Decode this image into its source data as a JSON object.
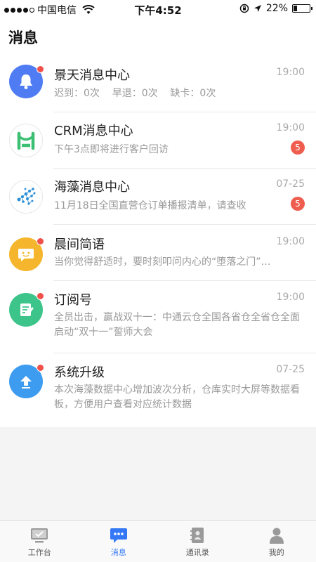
{
  "status": {
    "carrier": "中国电信",
    "time": "下午4:52",
    "battery": "22%",
    "battery_level": 0.22
  },
  "header": {
    "title": "消息"
  },
  "messages": [
    {
      "title": "景天消息中心",
      "time": "19:00",
      "subtitle": "迟到：0次    早退：0次    缺卡：0次",
      "icon": "bell-icon",
      "color": "#4f7cf3"
    },
    {
      "title": "CRM消息中心",
      "time": "19:00",
      "subtitle": "下午3点即将进行客户回访",
      "badge": "5",
      "icon": "crm-logo-icon",
      "color": "#3dbf73"
    },
    {
      "title": "海藻消息中心",
      "time": "07-25",
      "subtitle": "11月18日全国直营仓订单播报清单，请查收",
      "badge": "5",
      "icon": "seaweed-logo-icon",
      "color": "#2a8fd8"
    },
    {
      "title": "晨间简语",
      "time": "19:00",
      "subtitle": "当你觉得舒适时，要时刻叩问内心的“堕落之门”…",
      "icon": "chat-bubble-icon",
      "color": "#f5b62e"
    },
    {
      "title": "订阅号",
      "time": "19:00",
      "subtitle": "全员出击，赢战双十一：中通云仓全国各省仓全省仓全面启动“双十一”誓师大会",
      "icon": "document-icon",
      "color": "#3cc48a"
    },
    {
      "title": "系统升级",
      "time": "07-25",
      "subtitle": "本次海藻数据中心增加波次分析，仓库实时大屏等数据看板，方便用户查看对应统计数据",
      "icon": "upload-icon",
      "color": "#3d9cf0"
    }
  ],
  "tabs": [
    {
      "label": "工作台",
      "icon": "workbench-icon"
    },
    {
      "label": "消息",
      "icon": "message-icon",
      "active": true
    },
    {
      "label": "通讯录",
      "icon": "contacts-icon"
    },
    {
      "label": "我的",
      "icon": "profile-icon"
    }
  ]
}
